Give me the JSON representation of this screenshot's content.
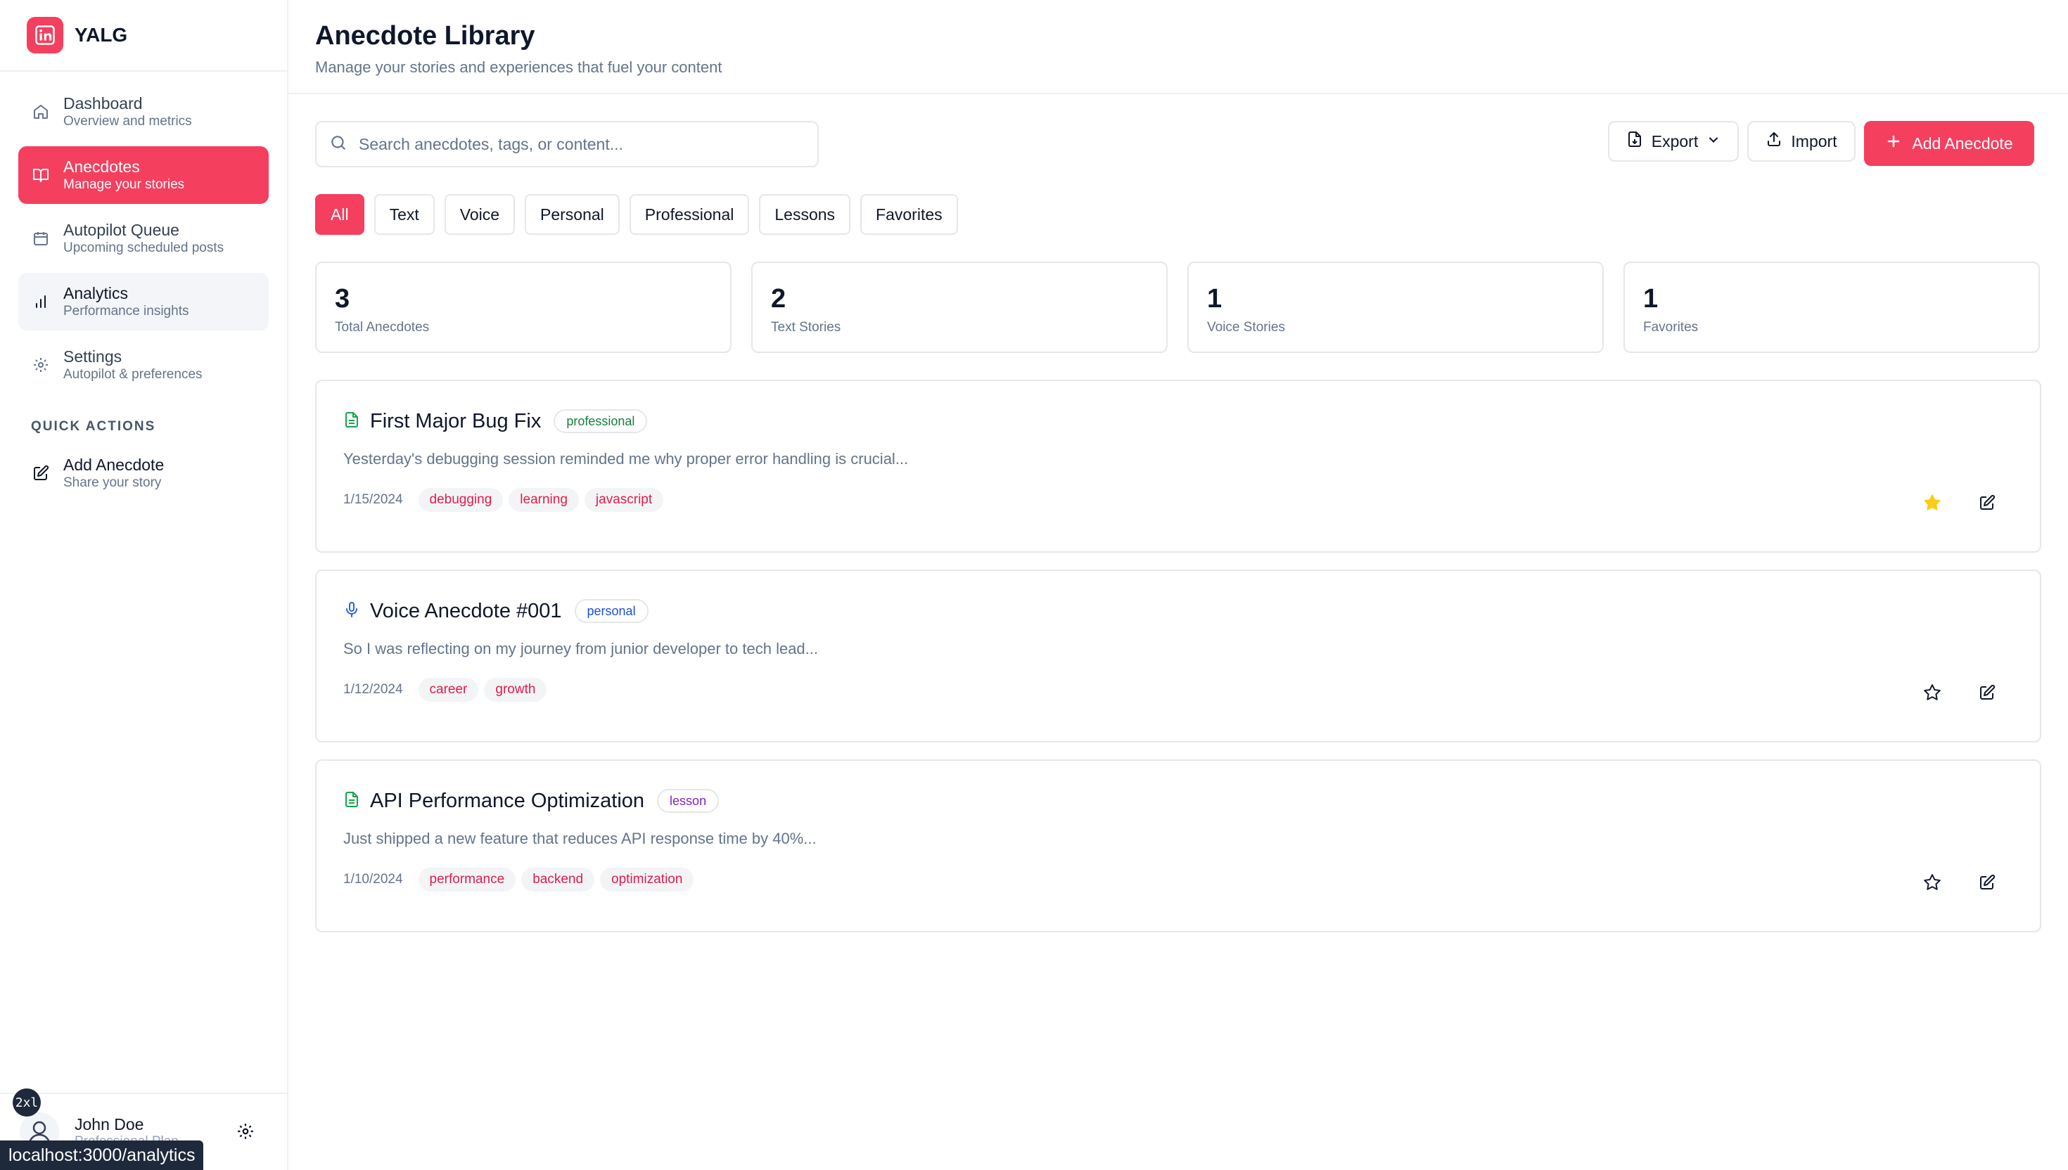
{
  "brand": {
    "name": "YALG",
    "logo_text": "in"
  },
  "sidebar": {
    "items": [
      {
        "title": "Dashboard",
        "subtitle": "Overview and metrics",
        "icon": "home-icon"
      },
      {
        "title": "Anecdotes",
        "subtitle": "Manage your stories",
        "icon": "book-icon"
      },
      {
        "title": "Autopilot Queue",
        "subtitle": "Upcoming scheduled posts",
        "icon": "calendar-icon"
      },
      {
        "title": "Analytics",
        "subtitle": "Performance insights",
        "icon": "bar-chart-icon"
      },
      {
        "title": "Settings",
        "subtitle": "Autopilot & preferences",
        "icon": "gear-icon"
      }
    ],
    "quick_actions_label": "QUICK ACTIONS",
    "quick_actions": [
      {
        "title": "Add Anecdote",
        "subtitle": "Share your story",
        "icon": "pencil-square-icon"
      }
    ]
  },
  "user": {
    "name": "John Doe",
    "plan": "Professional Plan",
    "badge": "2xl"
  },
  "url_tooltip": "localhost:3000/analytics",
  "header": {
    "title": "Anecdote Library",
    "subtitle": "Manage your stories and experiences that fuel your content"
  },
  "toolbar": {
    "search_placeholder": "Search anecdotes, tags, or content...",
    "export_label": "Export",
    "import_label": "Import",
    "add_label": "Add Anecdote"
  },
  "filters": [
    "All",
    "Text",
    "Voice",
    "Personal",
    "Professional",
    "Lessons",
    "Favorites"
  ],
  "stats": [
    {
      "value": "3",
      "label": "Total Anecdotes"
    },
    {
      "value": "2",
      "label": "Text Stories"
    },
    {
      "value": "1",
      "label": "Voice Stories"
    },
    {
      "value": "1",
      "label": "Favorites"
    }
  ],
  "anecdotes": [
    {
      "type": "text",
      "icon": "document-icon",
      "title": "First Major Bug Fix",
      "category": "professional",
      "excerpt": "Yesterday's debugging session reminded me why proper error handling is crucial...",
      "date": "1/15/2024",
      "tags": [
        "debugging",
        "learning",
        "javascript"
      ],
      "favorite": true
    },
    {
      "type": "voice",
      "icon": "microphone-icon",
      "title": "Voice Anecdote #001",
      "category": "personal",
      "excerpt": "So I was reflecting on my journey from junior developer to tech lead...",
      "date": "1/12/2024",
      "tags": [
        "career",
        "growth"
      ],
      "favorite": false
    },
    {
      "type": "text",
      "icon": "document-icon",
      "title": "API Performance Optimization",
      "category": "lesson",
      "excerpt": "Just shipped a new feature that reduces API response time by 40%...",
      "date": "1/10/2024",
      "tags": [
        "performance",
        "backend",
        "optimization"
      ],
      "favorite": false
    }
  ],
  "colors": {
    "accent": "#f43f5e",
    "professional": "#15803d",
    "personal": "#1d4ed8",
    "lesson": "#7e22ce",
    "text_icon": "#16a34a",
    "voice_icon": "#2563eb",
    "star_filled": "#facc15"
  }
}
